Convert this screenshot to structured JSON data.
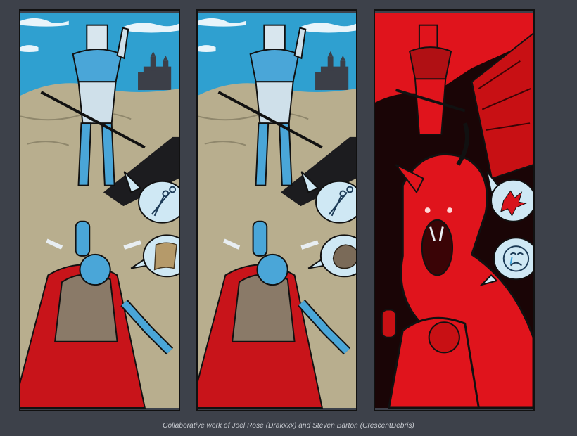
{
  "caption": "Collaborative work of Joel Rose (Drakxxx) and Steven Barton (CrescentDebris)",
  "colors": {
    "page_background": "#3d414a",
    "sky": "#2fa0d0",
    "sand": "#b8ae8e",
    "knight_blue": "#5ab4e0",
    "cape_red": "#c8141a",
    "dragon_red": "#e0141c",
    "bubble": "#cfe8f4"
  },
  "panels": [
    {
      "scene": "knight-rps",
      "top_bubble": "scissors-icon",
      "bottom_bubble": "paper-icon"
    },
    {
      "scene": "knight-rps",
      "top_bubble": "scissors-icon",
      "bottom_bubble": "rock-icon"
    },
    {
      "scene": "dragon-attack",
      "top_bubble": "dragon-icon",
      "bottom_bubble": "crying-face-icon"
    }
  ]
}
